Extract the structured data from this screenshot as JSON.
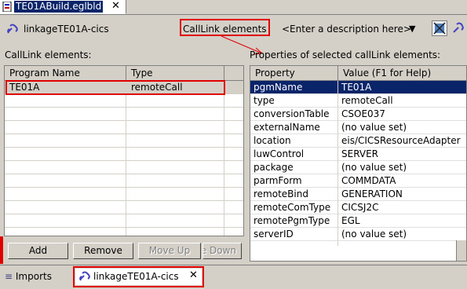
{
  "editor_tab": {
    "title": "TE01ABuild.eglbld",
    "close": "✕"
  },
  "header": {
    "title": "linkageTE01A-cics",
    "section_button": "CallLink elements",
    "description_placeholder": "<Enter a description here>",
    "dropdown_arrow": "▼"
  },
  "left_panel": {
    "label": "CallLink elements:",
    "columns": [
      "Program Name",
      "Type"
    ],
    "rows": [
      {
        "program_name": "TE01A",
        "type": "remoteCall"
      }
    ]
  },
  "right_panel": {
    "label": "Properties of selected callLink elements:",
    "columns": [
      "Property",
      "Value (F1 for Help)"
    ],
    "rows": [
      {
        "property": "pgmName",
        "value": "TE01A"
      },
      {
        "property": "type",
        "value": "remoteCall"
      },
      {
        "property": "conversionTable",
        "value": "CSOE037"
      },
      {
        "property": "externalName",
        "value": "(no value set)"
      },
      {
        "property": "location",
        "value": "eis/CICSResourceAdapter"
      },
      {
        "property": "luwControl",
        "value": "SERVER"
      },
      {
        "property": "package",
        "value": "(no value set)"
      },
      {
        "property": "parmForm",
        "value": "COMMDATA"
      },
      {
        "property": "remoteBind",
        "value": "GENERATION"
      },
      {
        "property": "remoteComType",
        "value": "CICSJ2C"
      },
      {
        "property": "remotePgmType",
        "value": "EGL"
      },
      {
        "property": "serverID",
        "value": "(no value set)"
      }
    ]
  },
  "buttons": {
    "add": "Add",
    "remove": "Remove",
    "move_up": "Move Up",
    "move_down": "Move Down"
  },
  "bottom_tabs": {
    "imports": "Imports",
    "imports_glyph": "≡",
    "linkage": "linkageTE01A-cics",
    "close": "✕"
  },
  "colors": {
    "selection": "#0a246a",
    "highlight_box": "#e00000",
    "annotation_arrow": "#e00000"
  }
}
